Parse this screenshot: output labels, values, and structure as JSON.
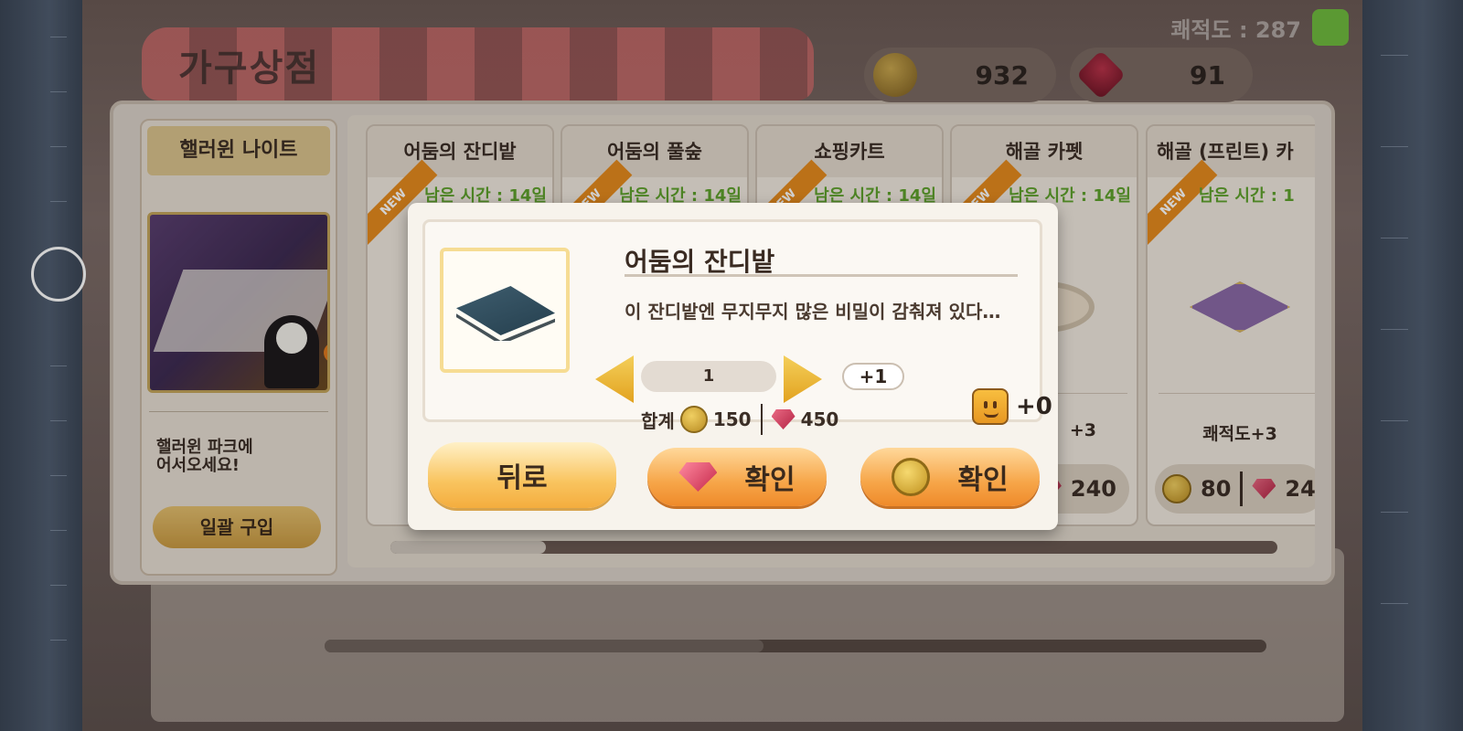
{
  "hud": {
    "comfort_label": "쾌적도 : 287"
  },
  "shop": {
    "title": "가구상점",
    "gold": "932",
    "gems": "91",
    "event": {
      "title": "핼러윈 나이트",
      "desc_line1": "핼러윈 파크에",
      "desc_line2": "어서오세요!",
      "bulk_buy": "일괄 구입"
    },
    "items": [
      {
        "name": "어둠의 잔디밭",
        "time": "남은 시간 : 14일",
        "new": "NEW"
      },
      {
        "name": "어둠의 풀숲",
        "time": "남은 시간 : 14일",
        "new": "NEW"
      },
      {
        "name": "쇼핑카트",
        "time": "남은 시간 : 14일",
        "new": "NEW"
      },
      {
        "name": "해골 카펫",
        "time": "남은 시간 : 14일",
        "new": "NEW",
        "stat": "+3",
        "gem_price": "240"
      },
      {
        "name": "해골 (프린트) 카",
        "time": "남은 시간 : 1",
        "new": "NEW",
        "stat": "쾌적도+3",
        "gold_price": "80",
        "gem_price": "24"
      }
    ]
  },
  "modal": {
    "title": "어둠의 잔디밭",
    "description": "이 잔디밭엔 무지무지 많은 비밀이 감춰져 있다…",
    "quantity": "1",
    "plus_label": "+1",
    "total_label": "합계",
    "total_gold": "150",
    "total_gems": "450",
    "comfort_gain": "+0",
    "back_label": "뒤로",
    "confirm_gem_label": "확인",
    "confirm_gold_label": "확인"
  }
}
